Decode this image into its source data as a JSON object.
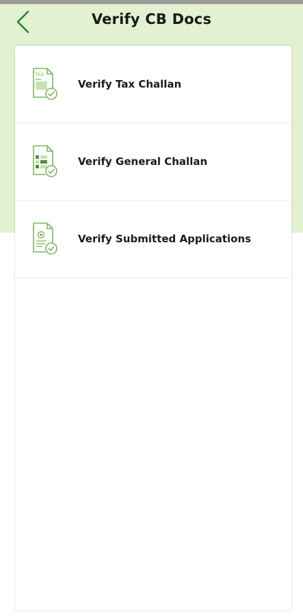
{
  "header": {
    "title": "Verify CB Docs"
  },
  "icons": {
    "back": "chevron-left-icon"
  },
  "colors": {
    "accent": "#2e7d32",
    "header_bg": "#e2f1d2",
    "icon_green": "#7cb45c"
  },
  "items": [
    {
      "label": "Verify Tax Challan",
      "icon": "tax-document-check-icon",
      "icon_text": "TAX"
    },
    {
      "label": "Verify General Challan",
      "icon": "general-challan-check-icon"
    },
    {
      "label": "Verify Submitted Applications",
      "icon": "application-check-icon"
    }
  ]
}
